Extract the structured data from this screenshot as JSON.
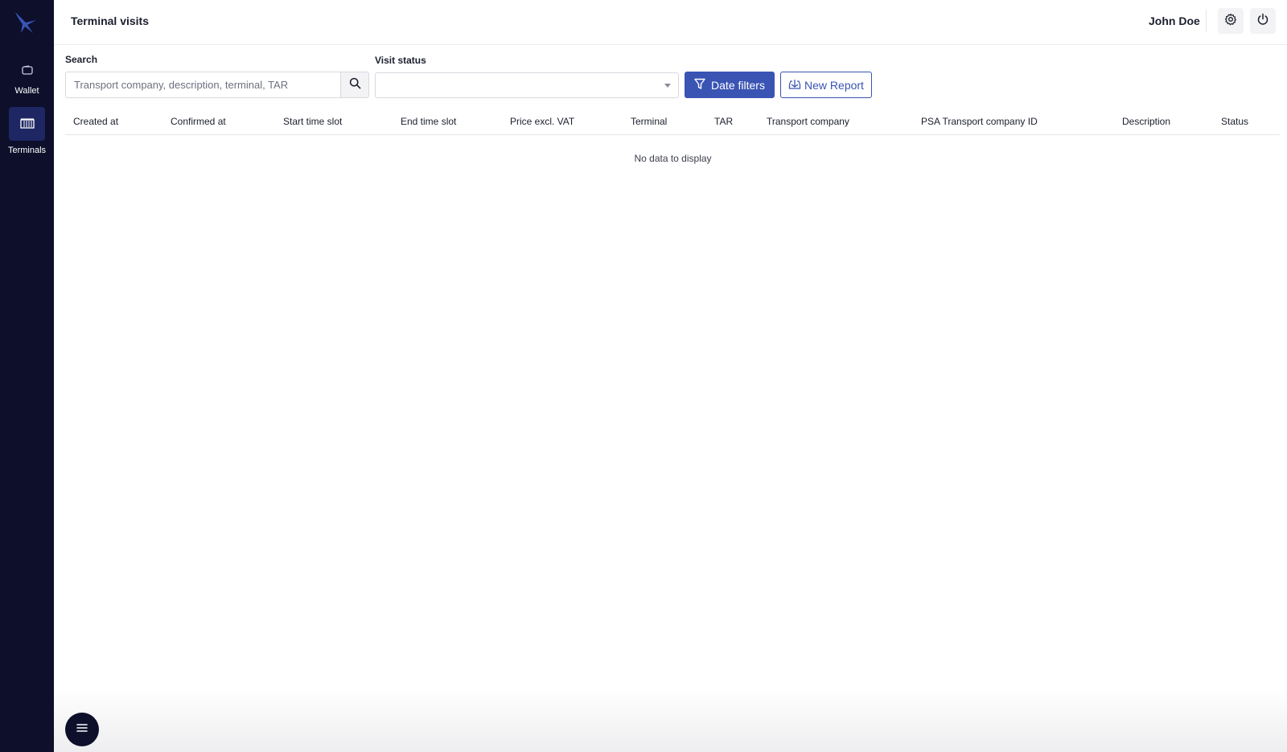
{
  "sidebar": {
    "logo_icon": "bird-logo-icon",
    "items": [
      {
        "label": "Wallet",
        "icon": "wallet-icon",
        "active": false
      },
      {
        "label": "Terminals",
        "icon": "terminal-grid-icon",
        "active": true
      }
    ]
  },
  "header": {
    "title": "Terminal visits",
    "user_name": "John Doe",
    "settings_icon": "gear-icon",
    "power_icon": "power-icon"
  },
  "filters": {
    "search_label": "Search",
    "search_placeholder": "Transport company, description, terminal, TAR",
    "search_value": "",
    "status_label": "Visit status",
    "status_value": "",
    "date_filters_label": "Date filters",
    "new_report_label": "New Report"
  },
  "table": {
    "columns": [
      "Created at",
      "Confirmed at",
      "Start time slot",
      "End time slot",
      "Price excl. VAT",
      "Terminal",
      "TAR",
      "Transport company",
      "PSA Transport company ID",
      "Description",
      "Status"
    ],
    "rows": [],
    "empty_message": "No data to display"
  },
  "colors": {
    "sidebar_bg": "#0d0f2b",
    "accent": "#3a54b4",
    "active_nav": "#1e2763"
  }
}
